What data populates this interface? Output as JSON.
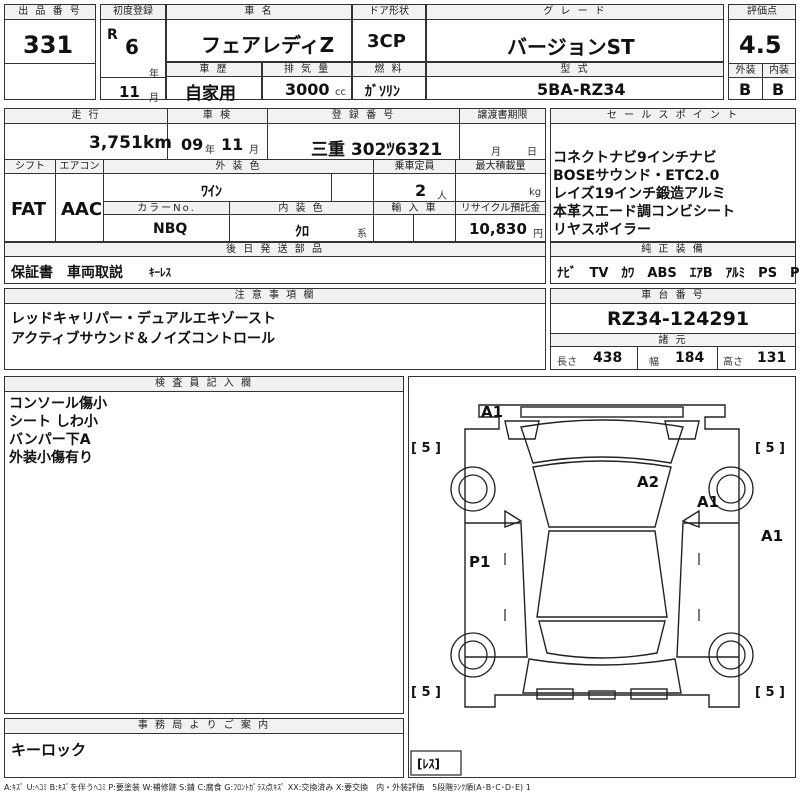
{
  "header": {
    "lot_label": "出 品 番 号",
    "lot_value": "331",
    "first_reg_label": "初度登録",
    "era": "R",
    "year": "6",
    "year_unit": "年",
    "month": "11",
    "month_unit": "月",
    "car_name_label": "車 名",
    "car_name": "フェアレディZ",
    "door_label": "ドア形状",
    "door": "3CP",
    "grade_label": "グ レ ー ド",
    "grade": "バージョンST",
    "score_label": "評価点",
    "score": "4.5",
    "history_label": "車 歴",
    "history": "自家用",
    "cc_label": "排 気 量",
    "cc": "3000",
    "cc_unit": "cc",
    "fuel_label": "燃 料",
    "fuel": "ｶﾞｿﾘﾝ",
    "model_label": "型 式",
    "model": "5BA-RZ34",
    "ext_label": "外装",
    "ext": "B",
    "int_label": "内装",
    "int": "B"
  },
  "row2": {
    "mileage_label": "走 行",
    "mileage": "3,751",
    "mileage_unit": "km",
    "inspection_label": "車 検",
    "insp_year": "09",
    "insp_year_unit": "年",
    "insp_month": "11",
    "insp_month_unit": "月",
    "plate_label": "登 録 番 号",
    "plate": "三重 302ﾂ6321",
    "transfer_label": "譲渡書期限",
    "transfer_month_unit": "月",
    "transfer_day_unit": "日",
    "shift_label": "シフト",
    "shift": "FAT",
    "ac_label": "エアコン",
    "ac": "AAC",
    "color_label": "外 装 色",
    "color": "ﾜｲﾝ",
    "capacity_label": "乗車定員",
    "capacity": "2",
    "capacity_unit": "人",
    "load_label": "最大積載量",
    "load_unit": "kg",
    "color_no_label": "カラーNo.",
    "color_no": "NBQ",
    "int_color_label": "内 装 色",
    "int_color": "ｸﾛ",
    "int_color_unit": "系",
    "import_label": "輸 入 車",
    "recycle_label": "リサイクル預託金",
    "recycle": "10,830",
    "recycle_unit": "円"
  },
  "sales": {
    "label": "セ ー ル ス ポ イ ン ト",
    "lines": [
      "コネクトナビ9インチナビ",
      "BOSEサウンド・ETC2.0",
      "レイズ19インチ鍛造アルミ",
      "本革スエード調コンビシート",
      "リヤスポイラー"
    ]
  },
  "later": {
    "label": "後 日 発 送 部 品",
    "items": "保証書　車両取説",
    "extra": "ｷｰﾚｽ"
  },
  "equip": {
    "label": "純 正 装 備",
    "items": "ﾅﾋﾞ　TV　ｶﾜ　ABS　ｴｱB　ｱﾙﾐ　PS　PW"
  },
  "notes": {
    "label": "注 意 事 項 欄",
    "lines": [
      "レッドキャリパー・デュアルエキゾースト",
      "アクティブサウンド＆ノイズコントロール"
    ]
  },
  "chassis": {
    "label": "車 台 番 号",
    "value": "RZ34-124291"
  },
  "dims": {
    "label": "諸 元",
    "len_label": "長さ",
    "len": "438",
    "wid_label": "幅",
    "wid": "184",
    "hgt_label": "高さ",
    "hgt": "131"
  },
  "inspector": {
    "label": "検 査 員 記 入 欄",
    "lines": [
      "コンソール傷小",
      "シート しわ小",
      "バンパー下A",
      "外装小傷有り"
    ]
  },
  "office": {
    "label": "事 務 局 よ り ご 案 内",
    "text": "キーロック"
  },
  "diagram": {
    "marks": [
      "A1",
      "A2",
      "A1",
      "A1",
      "P1"
    ],
    "tires": [
      "[ 5 ]",
      "[ 5 ]",
      "[ 5 ]",
      "[ 5 ]"
    ],
    "spare": "[ﾚｽ]"
  },
  "legend": "A:ｷｽﾞ U:ﾍｺﾐ B:ｷｽﾞを伴うﾍｺﾐ P:要塗装 W:補修跡 S:錆 C:腐食 G:ﾌﾛﾝﾄｶﾞﾗｽ点ｷｽﾞ XX:交換済み X:要交換　内・外装評価　5段階ﾗﾝｸ順(A･B･C･D･E) 1"
}
